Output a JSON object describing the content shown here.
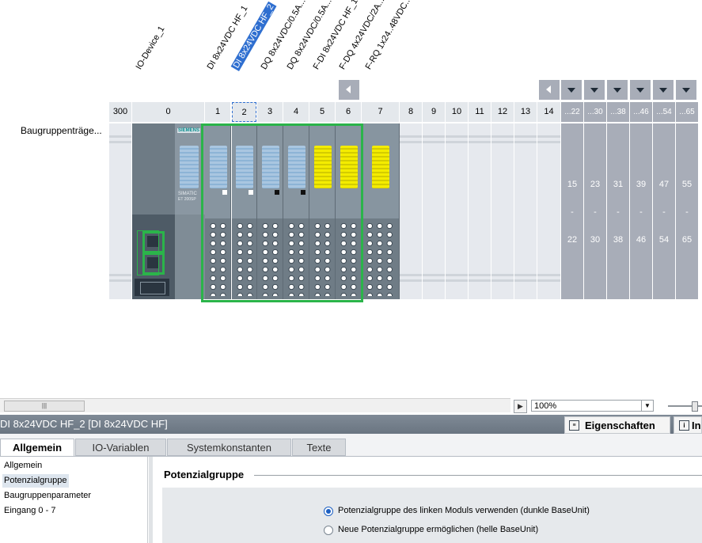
{
  "device_labels": [
    {
      "text": "IO-Device_1"
    },
    {
      "text": "DI 8x24VDC HF_1"
    },
    {
      "text": "DI 8x24VDC HF_2"
    },
    {
      "text": "DQ 8x24VDC/0.5A..."
    },
    {
      "text": "DQ 8x24VDC/0.5A..."
    },
    {
      "text": "F-DI 8x24VDC HF_1"
    },
    {
      "text": "F-DQ 4x24VDC/2A..."
    },
    {
      "text": "F-RQ 1x24..48VDC..."
    }
  ],
  "slot_numbers": [
    "300",
    "0",
    "1",
    "2",
    "3",
    "4",
    "5",
    "6",
    "7",
    "8",
    "9",
    "10",
    "11",
    "12",
    "13",
    "14"
  ],
  "expansion_headers": [
    "...22",
    "...30",
    "...38",
    "...46",
    "...54",
    "...65"
  ],
  "expansion_ranges": [
    {
      "start": "15",
      "sep": "-",
      "end": "22"
    },
    {
      "start": "23",
      "sep": "-",
      "end": "30"
    },
    {
      "start": "31",
      "sep": "-",
      "end": "38"
    },
    {
      "start": "39",
      "sep": "-",
      "end": "46"
    },
    {
      "start": "47",
      "sep": "-",
      "end": "54"
    },
    {
      "start": "55",
      "sep": "-",
      "end": "65"
    }
  ],
  "rack_label": "Baugruppenträge...",
  "module_texts": {
    "brand": "SIEMENS",
    "model": "SIMATIC",
    "sub": "ET 200SP"
  },
  "zoom": {
    "value": "100%"
  },
  "scrollbar_thumb": "|||",
  "inspector": {
    "title": "DI 8x24VDC HF_2 [DI 8x24VDC HF]",
    "properties_label": "Eigenschaften",
    "info_label": "In",
    "tabs": [
      "Allgemein",
      "IO-Variablen",
      "Systemkonstanten",
      "Texte"
    ],
    "nav": [
      "Allgemein",
      "Potenzialgruppe",
      "Baugruppenparameter",
      "Eingang 0 - 7"
    ],
    "section_title": "Potenzialgruppe",
    "options": [
      {
        "label": "Potenzialgruppe des linken Moduls verwenden (dunkle BaseUnit)",
        "selected": true
      },
      {
        "label": "Neue Potenzialgruppe ermöglichen (helle BaseUnit)",
        "selected": false
      }
    ]
  },
  "colors": {
    "selection": "#2f6fd0",
    "highlight": "#2bb44a",
    "module_yellow": "#f4ec00",
    "module_blue": "#a9c6e0",
    "expansion": "#a8adb8"
  }
}
